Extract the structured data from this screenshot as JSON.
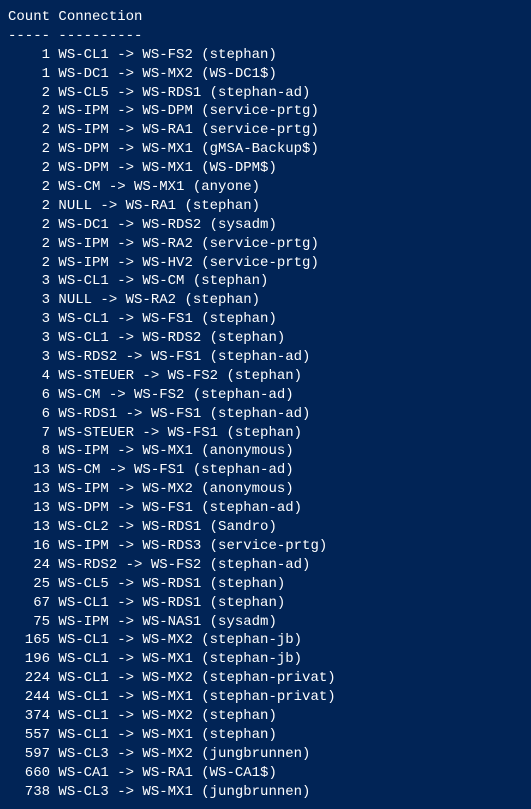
{
  "headers": {
    "count": "Count",
    "connection": "Connection"
  },
  "divider": {
    "count": "-----",
    "connection": "----------"
  },
  "rows": [
    {
      "count": 1,
      "connection": "WS-CL1 -> WS-FS2 (stephan)"
    },
    {
      "count": 1,
      "connection": "WS-DC1 -> WS-MX2 (WS-DC1$)"
    },
    {
      "count": 2,
      "connection": "WS-CL5 -> WS-RDS1 (stephan-ad)"
    },
    {
      "count": 2,
      "connection": "WS-IPM -> WS-DPM (service-prtg)"
    },
    {
      "count": 2,
      "connection": "WS-IPM -> WS-RA1 (service-prtg)"
    },
    {
      "count": 2,
      "connection": "WS-DPM -> WS-MX1 (gMSA-Backup$)"
    },
    {
      "count": 2,
      "connection": "WS-DPM -> WS-MX1 (WS-DPM$)"
    },
    {
      "count": 2,
      "connection": "WS-CM -> WS-MX1 (anyone)"
    },
    {
      "count": 2,
      "connection": "NULL -> WS-RA1 (stephan)"
    },
    {
      "count": 2,
      "connection": "WS-DC1 -> WS-RDS2 (sysadm)"
    },
    {
      "count": 2,
      "connection": "WS-IPM -> WS-RA2 (service-prtg)"
    },
    {
      "count": 2,
      "connection": "WS-IPM -> WS-HV2 (service-prtg)"
    },
    {
      "count": 3,
      "connection": "WS-CL1 -> WS-CM (stephan)"
    },
    {
      "count": 3,
      "connection": "NULL -> WS-RA2 (stephan)"
    },
    {
      "count": 3,
      "connection": "WS-CL1 -> WS-FS1 (stephan)"
    },
    {
      "count": 3,
      "connection": "WS-CL1 -> WS-RDS2 (stephan)"
    },
    {
      "count": 3,
      "connection": "WS-RDS2 -> WS-FS1 (stephan-ad)"
    },
    {
      "count": 4,
      "connection": "WS-STEUER -> WS-FS2 (stephan)"
    },
    {
      "count": 6,
      "connection": "WS-CM -> WS-FS2 (stephan-ad)"
    },
    {
      "count": 6,
      "connection": "WS-RDS1 -> WS-FS1 (stephan-ad)"
    },
    {
      "count": 7,
      "connection": "WS-STEUER -> WS-FS1 (stephan)"
    },
    {
      "count": 8,
      "connection": "WS-IPM -> WS-MX1 (anonymous)"
    },
    {
      "count": 13,
      "connection": "WS-CM -> WS-FS1 (stephan-ad)"
    },
    {
      "count": 13,
      "connection": "WS-IPM -> WS-MX2 (anonymous)"
    },
    {
      "count": 13,
      "connection": "WS-DPM -> WS-FS1 (stephan-ad)"
    },
    {
      "count": 13,
      "connection": "WS-CL2 -> WS-RDS1 (Sandro)"
    },
    {
      "count": 16,
      "connection": "WS-IPM -> WS-RDS3 (service-prtg)"
    },
    {
      "count": 24,
      "connection": "WS-RDS2 -> WS-FS2 (stephan-ad)"
    },
    {
      "count": 25,
      "connection": "WS-CL5 -> WS-RDS1 (stephan)"
    },
    {
      "count": 67,
      "connection": "WS-CL1 -> WS-RDS1 (stephan)"
    },
    {
      "count": 75,
      "connection": "WS-IPM -> WS-NAS1 (sysadm)"
    },
    {
      "count": 165,
      "connection": "WS-CL1 -> WS-MX2 (stephan-jb)"
    },
    {
      "count": 196,
      "connection": "WS-CL1 -> WS-MX1 (stephan-jb)"
    },
    {
      "count": 224,
      "connection": "WS-CL1 -> WS-MX2 (stephan-privat)"
    },
    {
      "count": 244,
      "connection": "WS-CL1 -> WS-MX1 (stephan-privat)"
    },
    {
      "count": 374,
      "connection": "WS-CL1 -> WS-MX2 (stephan)"
    },
    {
      "count": 557,
      "connection": "WS-CL1 -> WS-MX1 (stephan)"
    },
    {
      "count": 597,
      "connection": "WS-CL3 -> WS-MX2 (jungbrunnen)"
    },
    {
      "count": 660,
      "connection": "WS-CA1 -> WS-RA1 (WS-CA1$)"
    },
    {
      "count": 738,
      "connection": "WS-CL3 -> WS-MX1 (jungbrunnen)"
    }
  ]
}
